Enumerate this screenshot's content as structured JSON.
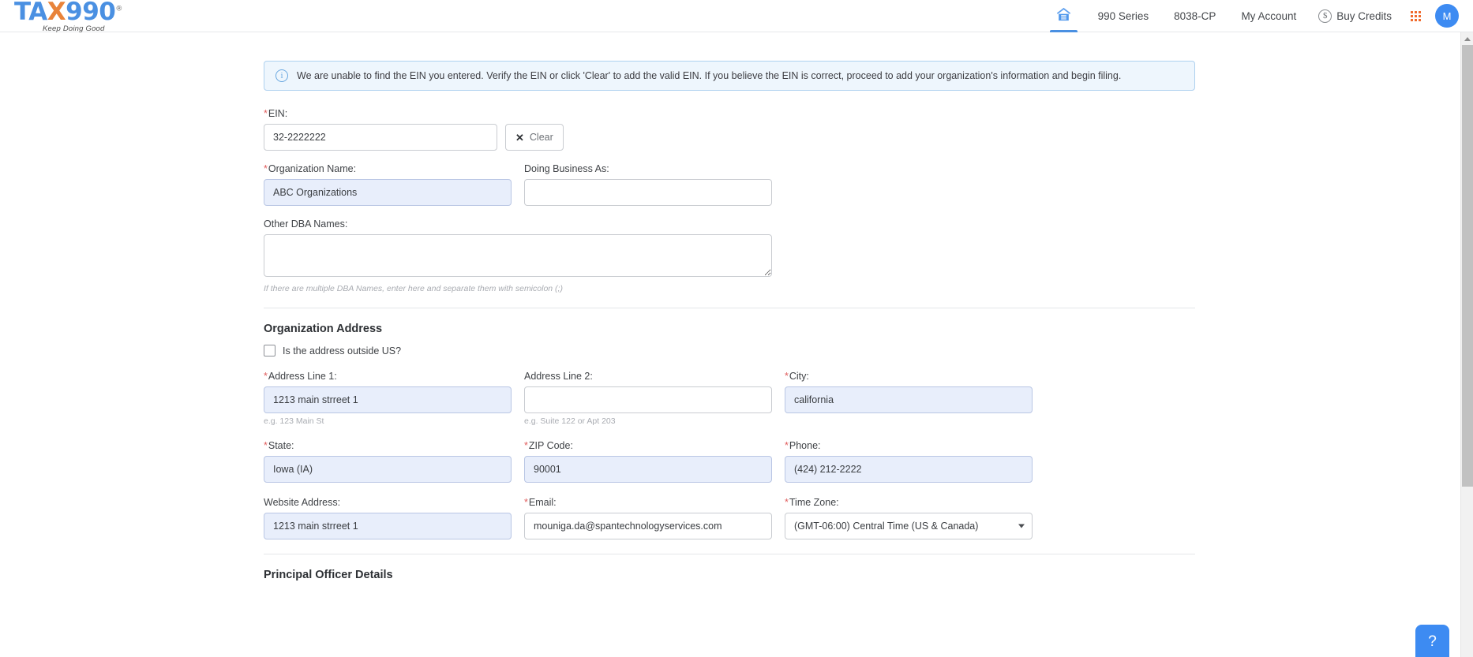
{
  "header": {
    "logo": {
      "text_left": "TA",
      "text_x": "X",
      "text_right": "990",
      "registered": "®",
      "tagline": "Keep Doing Good"
    },
    "nav": {
      "home_icon": "home-icon",
      "links": [
        {
          "label": "990 Series"
        },
        {
          "label": "8038-CP"
        },
        {
          "label": "My Account"
        }
      ],
      "buy_credits": "Buy Credits",
      "dollar_icon": "dollar-circle-icon",
      "apps_icon": "apps-grid-icon",
      "avatar_initial": "M"
    }
  },
  "alert": {
    "icon": "info-circle-icon",
    "message": "We are unable to find the EIN you entered. Verify the EIN or click 'Clear' to add the valid EIN. If you believe the EIN is correct, proceed to add your organization's information and begin filing."
  },
  "form": {
    "ein": {
      "label": "EIN:",
      "required": "*",
      "value": "32-2222222",
      "clear_label": "Clear",
      "clear_icon": "close-x-icon"
    },
    "org_name": {
      "label": "Organization Name:",
      "required": "*",
      "value": "ABC Organizations"
    },
    "doing_business_as": {
      "label": "Doing Business As:",
      "value": ""
    },
    "other_dba": {
      "label": "Other DBA Names:",
      "value": "",
      "hint": "If there are multiple DBA Names, enter here and separate them with semicolon (;)"
    },
    "address_section": {
      "title": "Organization Address",
      "outside_us_label": "Is the address outside US?",
      "outside_us_checked": false
    },
    "address_line_1": {
      "label": "Address Line 1:",
      "required": "*",
      "value": "1213 main strreet 1",
      "hint": "e.g. 123 Main St"
    },
    "address_line_2": {
      "label": "Address Line 2:",
      "value": "",
      "hint": "e.g. Suite 122 or Apt 203"
    },
    "city": {
      "label": "City:",
      "required": "*",
      "value": "california"
    },
    "state": {
      "label": "State:",
      "required": "*",
      "value": "Iowa (IA)"
    },
    "zip": {
      "label": "ZIP Code:",
      "required": "*",
      "value": "90001"
    },
    "phone": {
      "label": "Phone:",
      "required": "*",
      "value": "(424) 212-2222"
    },
    "website": {
      "label": "Website Address:",
      "value": "1213 main strreet 1"
    },
    "email": {
      "label": "Email:",
      "required": "*",
      "value": "mouniga.da@spantechnologyservices.com"
    },
    "timezone": {
      "label": "Time Zone:",
      "required": "*",
      "value": "(GMT-06:00) Central Time (US & Canada)"
    },
    "officer_section": {
      "title": "Principal Officer Details"
    }
  },
  "help": {
    "label": "?"
  },
  "colors": {
    "brand_blue": "#4a90e2",
    "brand_orange": "#e8833a",
    "accent": "#3d8bf2",
    "filled_field": "#e8eefb",
    "alert_bg": "#eef6fd",
    "alert_border": "#aed1ef",
    "required_red": "#e05c5c"
  }
}
